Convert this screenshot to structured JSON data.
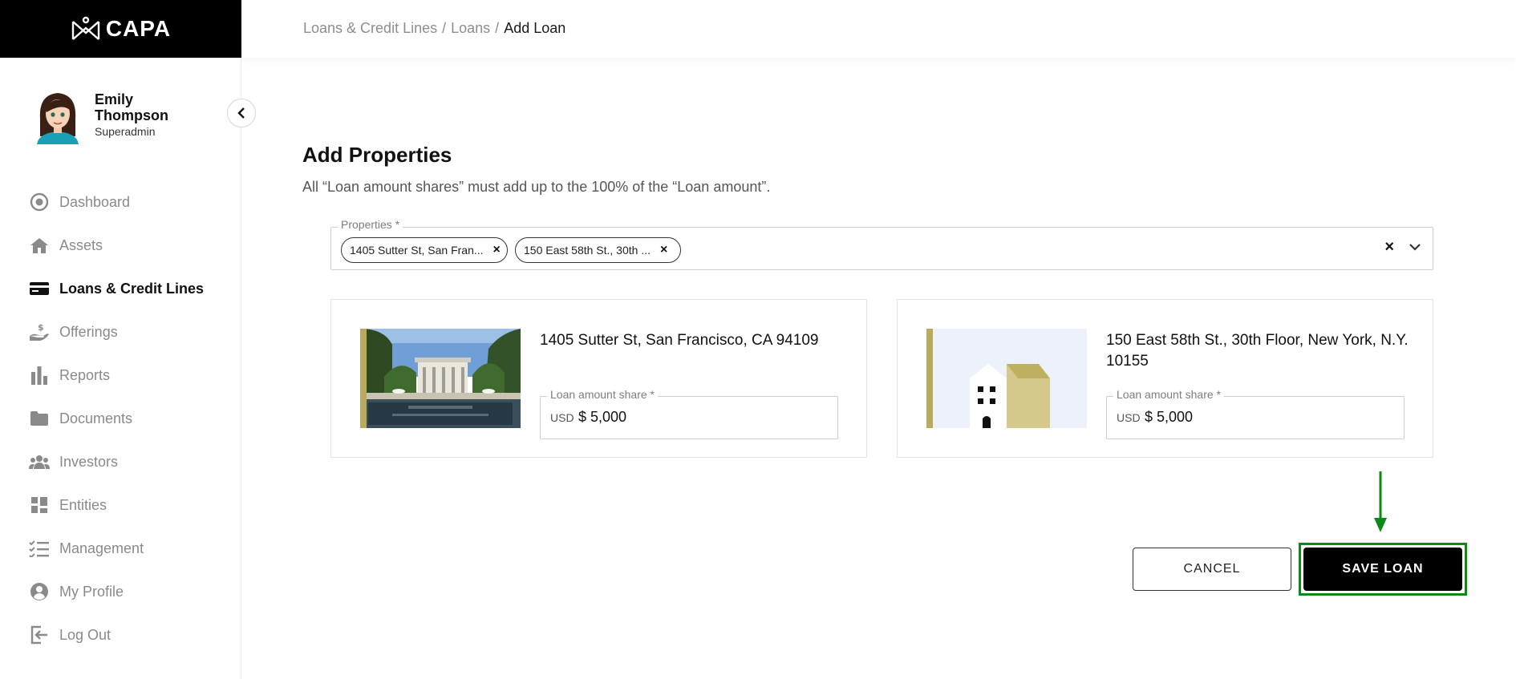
{
  "brand": {
    "name": "CAPA"
  },
  "user": {
    "name": "Emily Thompson",
    "role": "Superadmin"
  },
  "nav": {
    "items": [
      {
        "label": "Dashboard",
        "icon": "dashboard-icon",
        "active": false
      },
      {
        "label": "Assets",
        "icon": "home-icon",
        "active": false
      },
      {
        "label": "Loans & Credit Lines",
        "icon": "credit-card-icon",
        "active": true
      },
      {
        "label": "Offerings",
        "icon": "hand-dollar-icon",
        "active": false
      },
      {
        "label": "Reports",
        "icon": "bar-chart-icon",
        "active": false
      },
      {
        "label": "Documents",
        "icon": "folder-icon",
        "active": false
      },
      {
        "label": "Investors",
        "icon": "people-icon",
        "active": false
      },
      {
        "label": "Entities",
        "icon": "grid-icon",
        "active": false
      },
      {
        "label": "Management",
        "icon": "checklist-icon",
        "active": false
      },
      {
        "label": "My Profile",
        "icon": "user-circle-icon",
        "active": false
      },
      {
        "label": "Log Out",
        "icon": "logout-icon",
        "active": false
      }
    ]
  },
  "breadcrumb": {
    "items": [
      "Loans & Credit Lines",
      "Loans"
    ],
    "separator": "/",
    "current": "Add Loan"
  },
  "main": {
    "title": "Add Properties",
    "description": "All “Loan amount shares” must add up to the 100% of the “Loan amount”.",
    "properties_label": "Properties *",
    "chips": [
      "1405 Sutter St, San Fran...",
      "150 East 58th St., 30th ..."
    ],
    "chip_remove": "×",
    "clear": "×"
  },
  "cards": [
    {
      "title": "1405 Sutter St, San Francisco, CA 94109",
      "share_label": "Loan amount share *",
      "currency": "USD",
      "value": "$ 5,000"
    },
    {
      "title": "150 East 58th St., 30th Floor, New York, N.Y. 10155",
      "share_label": "Loan amount share *",
      "currency": "USD",
      "value": "$ 5,000"
    }
  ],
  "actions": {
    "cancel": "CANCEL",
    "save": "SAVE LOAN"
  },
  "colors": {
    "accent": "#b9ab5b",
    "highlight": "#0c8a16",
    "primary": "#000000"
  }
}
